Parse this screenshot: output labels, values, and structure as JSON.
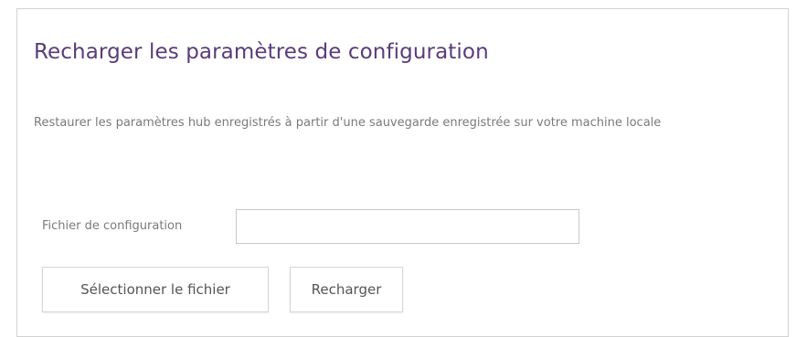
{
  "panel": {
    "title": "Recharger les paramètres de configuration",
    "description": "Restaurer les paramètres hub enregistrés à partir d'une sauvegarde enregistrée sur votre machine locale",
    "config_file": {
      "label": "Fichier de configuration",
      "value": "",
      "placeholder": ""
    },
    "buttons": {
      "select_file": "Sélectionner le fichier",
      "reload": "Recharger"
    }
  },
  "colors": {
    "title": "#5a3c7a",
    "text": "#7a7a7a",
    "border": "#d2d2d2"
  }
}
